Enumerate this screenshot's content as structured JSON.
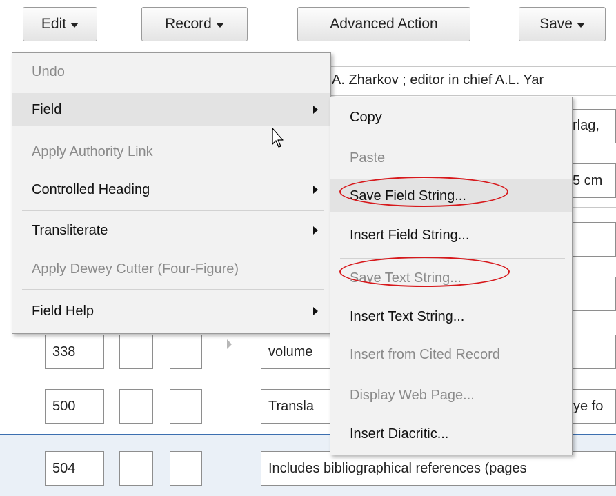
{
  "toolbar": {
    "edit_label": "Edit",
    "record_label": "Record",
    "advanced_label": "Advanced Action",
    "save_label": "Save"
  },
  "background": {
    "line1_text": "A. Zharkov ; editor in chief A.L. Yar",
    "line2_text": "rlag,",
    "line3_text": "5 cm",
    "rows": [
      {
        "tag": "338",
        "ind1": "",
        "ind2": "",
        "text": "volume"
      },
      {
        "tag": "500",
        "ind1": "",
        "ind2": "",
        "text": "Transla",
        "text_right": "ye fo"
      },
      {
        "tag": "504",
        "ind1": "",
        "ind2": "",
        "text": "Includes bibliographical references (pages"
      }
    ]
  },
  "edit_menu": {
    "items": [
      {
        "label": "Undo",
        "enabled": false,
        "submenu": false
      },
      {
        "label": "Field",
        "enabled": true,
        "submenu": true
      },
      {
        "label": "Apply Authority Link",
        "enabled": false,
        "submenu": false
      },
      {
        "label": "Controlled Heading",
        "enabled": true,
        "submenu": true
      },
      {
        "label": "Transliterate",
        "enabled": true,
        "submenu": true
      },
      {
        "label": "Apply Dewey Cutter (Four-Figure)",
        "enabled": false,
        "submenu": false
      },
      {
        "label": "Field Help",
        "enabled": true,
        "submenu": true
      }
    ]
  },
  "field_submenu": {
    "items": [
      {
        "label": "Copy",
        "enabled": true
      },
      {
        "label": "Paste",
        "enabled": false
      },
      {
        "label": "Save Field String...",
        "enabled": true
      },
      {
        "label": "Insert Field String...",
        "enabled": true
      },
      {
        "label": "Save Text String...",
        "enabled": false
      },
      {
        "label": "Insert Text String...",
        "enabled": true
      },
      {
        "label": "Insert from Cited Record",
        "enabled": false
      },
      {
        "label": "Display Web Page...",
        "enabled": false
      },
      {
        "label": "Insert Diacritic...",
        "enabled": true
      }
    ]
  },
  "colors": {
    "highlight_oval": "#d7191c",
    "selected_row_border": "#3c6fb0"
  }
}
